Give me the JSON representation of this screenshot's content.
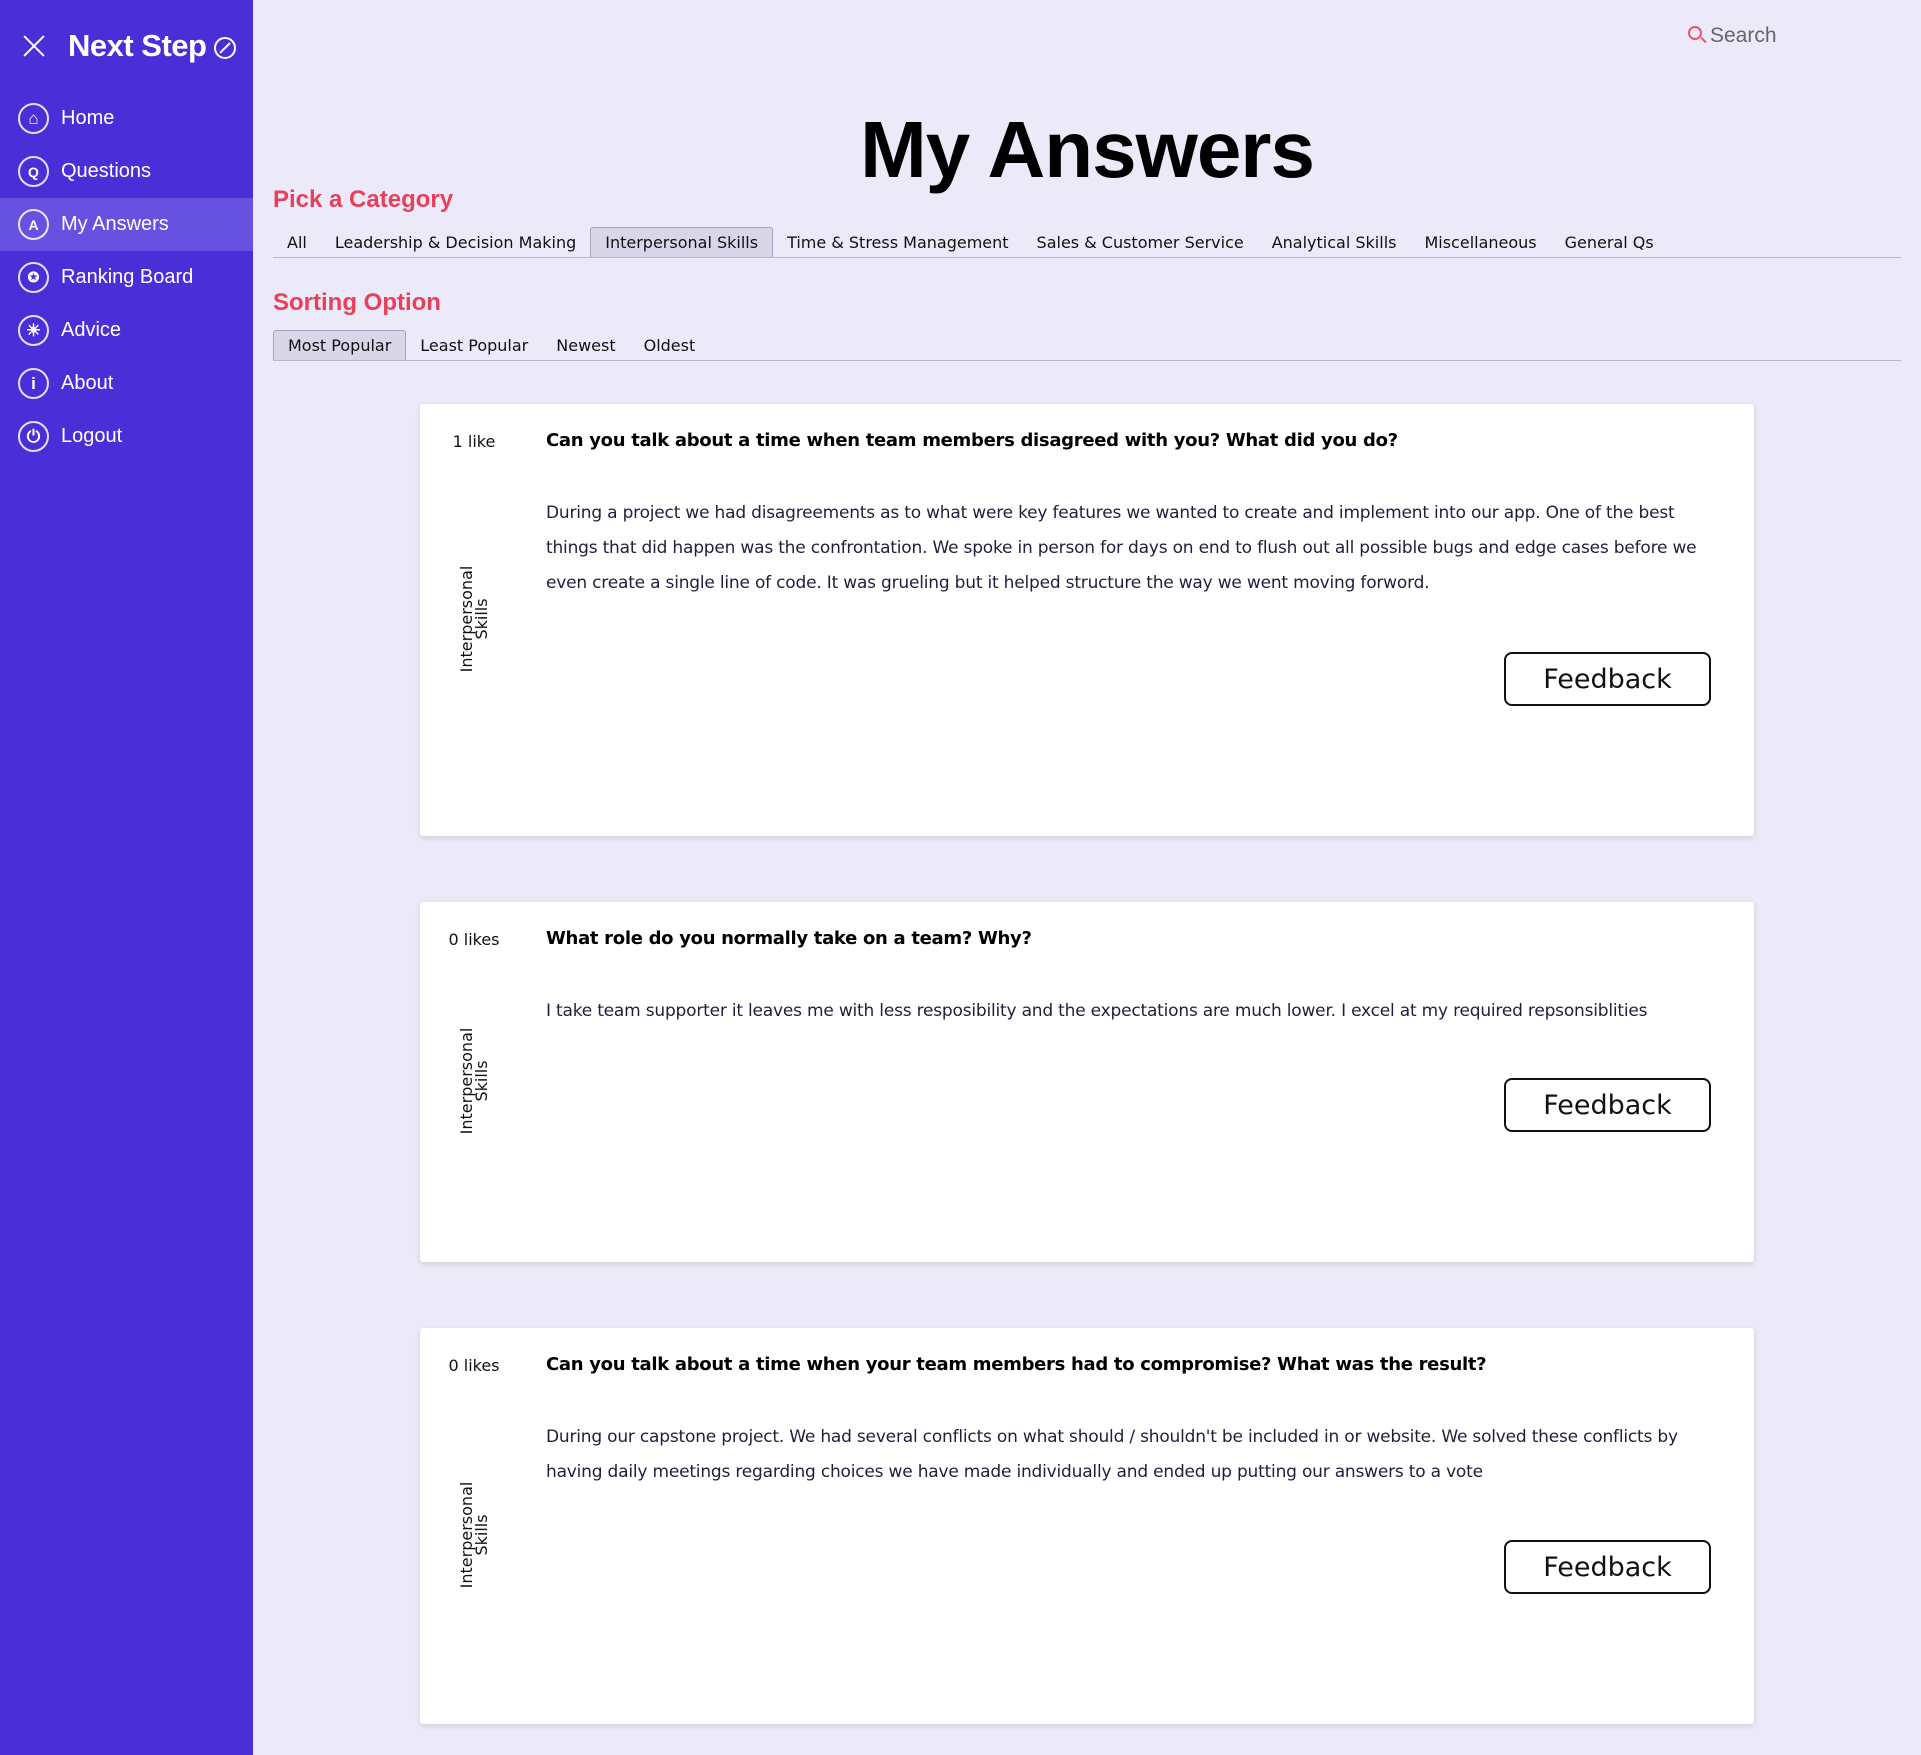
{
  "sidebar": {
    "brand": "Next Step",
    "items": [
      {
        "label": "Home",
        "icon": "home-icon",
        "glyph": "⌂"
      },
      {
        "label": "Questions",
        "icon": "questions-icon",
        "glyph": "Q"
      },
      {
        "label": "My Answers",
        "icon": "answers-icon",
        "glyph": "A"
      },
      {
        "label": "Ranking Board",
        "icon": "medal-icon",
        "glyph": "✪"
      },
      {
        "label": "Advice",
        "icon": "lightbulb-icon",
        "glyph": "☀"
      },
      {
        "label": "About",
        "icon": "info-icon",
        "glyph": "i"
      },
      {
        "label": "Logout",
        "icon": "power-icon",
        "glyph": "⏻"
      }
    ],
    "active_index": 2
  },
  "search": {
    "label": "Search"
  },
  "page_title": "My Answers",
  "category": {
    "heading": "Pick a Category",
    "tabs": [
      "All",
      "Leadership & Decision Making",
      "Interpersonal Skills",
      "Time & Stress Management",
      "Sales & Customer Service",
      "Analytical Skills",
      "Miscellaneous",
      "General Qs"
    ],
    "selected": "Interpersonal Skills"
  },
  "sorting": {
    "heading": "Sorting Option",
    "tabs": [
      "Most Popular",
      "Least Popular",
      "Newest",
      "Oldest"
    ],
    "selected": "Most Popular"
  },
  "answers": [
    {
      "likes": "1 like",
      "category_line1": "Interpersonal",
      "category_line2": "Skills",
      "question": "Can you talk about a time when team members disagreed with you? What did you do?",
      "answer": "During a project we had disagreements as to what were key features we wanted to create and implement into our app. One of the best things that did happen was the confrontation. We spoke in person for days on end to flush out all possible bugs and edge cases before we even create a single line of code. It was grueling but it helped structure the way we went moving forword.",
      "button": "Feedback"
    },
    {
      "likes": "0 likes",
      "category_line1": "Interpersonal",
      "category_line2": "Skills",
      "question": "What role do you normally take on a team? Why?",
      "answer": "I take team supporter it leaves me with less resposibility and the expectations are much lower. I excel at my required repsonsiblities",
      "button": "Feedback"
    },
    {
      "likes": "0 likes",
      "category_line1": "Interpersonal",
      "category_line2": "Skills",
      "question": "Can you talk about a time when your team members had to compromise? What was the result?",
      "answer": "During our capstone project. We had several conflicts on what should / shouldn't be included in or website. We solved these conflicts by having daily meetings regarding choices we have made individually and ended up putting our answers to a vote",
      "button": "Feedback"
    }
  ]
}
